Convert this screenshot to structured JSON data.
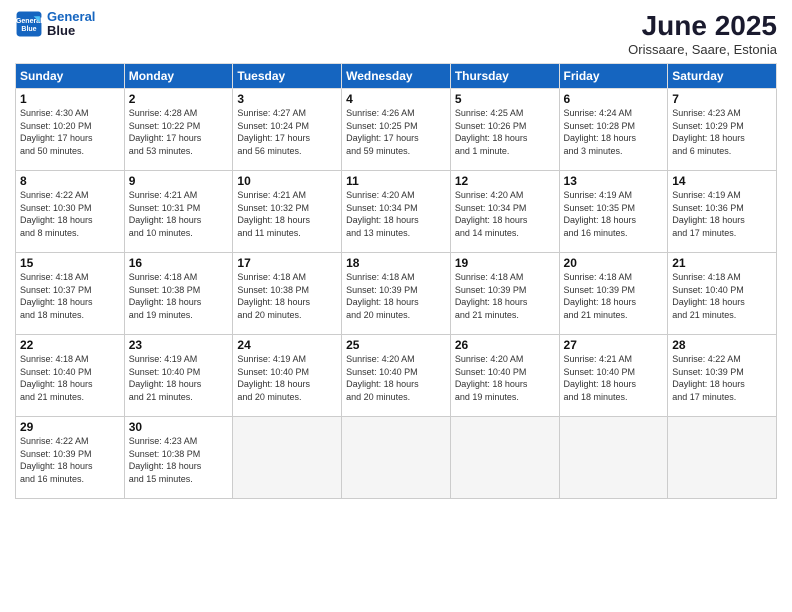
{
  "header": {
    "logo_line1": "General",
    "logo_line2": "Blue",
    "month": "June 2025",
    "location": "Orissaare, Saare, Estonia"
  },
  "weekdays": [
    "Sunday",
    "Monday",
    "Tuesday",
    "Wednesday",
    "Thursday",
    "Friday",
    "Saturday"
  ],
  "weeks": [
    [
      {
        "day": "1",
        "info": "Sunrise: 4:30 AM\nSunset: 10:20 PM\nDaylight: 17 hours\nand 50 minutes."
      },
      {
        "day": "2",
        "info": "Sunrise: 4:28 AM\nSunset: 10:22 PM\nDaylight: 17 hours\nand 53 minutes."
      },
      {
        "day": "3",
        "info": "Sunrise: 4:27 AM\nSunset: 10:24 PM\nDaylight: 17 hours\nand 56 minutes."
      },
      {
        "day": "4",
        "info": "Sunrise: 4:26 AM\nSunset: 10:25 PM\nDaylight: 17 hours\nand 59 minutes."
      },
      {
        "day": "5",
        "info": "Sunrise: 4:25 AM\nSunset: 10:26 PM\nDaylight: 18 hours\nand 1 minute."
      },
      {
        "day": "6",
        "info": "Sunrise: 4:24 AM\nSunset: 10:28 PM\nDaylight: 18 hours\nand 3 minutes."
      },
      {
        "day": "7",
        "info": "Sunrise: 4:23 AM\nSunset: 10:29 PM\nDaylight: 18 hours\nand 6 minutes."
      }
    ],
    [
      {
        "day": "8",
        "info": "Sunrise: 4:22 AM\nSunset: 10:30 PM\nDaylight: 18 hours\nand 8 minutes."
      },
      {
        "day": "9",
        "info": "Sunrise: 4:21 AM\nSunset: 10:31 PM\nDaylight: 18 hours\nand 10 minutes."
      },
      {
        "day": "10",
        "info": "Sunrise: 4:21 AM\nSunset: 10:32 PM\nDaylight: 18 hours\nand 11 minutes."
      },
      {
        "day": "11",
        "info": "Sunrise: 4:20 AM\nSunset: 10:34 PM\nDaylight: 18 hours\nand 13 minutes."
      },
      {
        "day": "12",
        "info": "Sunrise: 4:20 AM\nSunset: 10:34 PM\nDaylight: 18 hours\nand 14 minutes."
      },
      {
        "day": "13",
        "info": "Sunrise: 4:19 AM\nSunset: 10:35 PM\nDaylight: 18 hours\nand 16 minutes."
      },
      {
        "day": "14",
        "info": "Sunrise: 4:19 AM\nSunset: 10:36 PM\nDaylight: 18 hours\nand 17 minutes."
      }
    ],
    [
      {
        "day": "15",
        "info": "Sunrise: 4:18 AM\nSunset: 10:37 PM\nDaylight: 18 hours\nand 18 minutes."
      },
      {
        "day": "16",
        "info": "Sunrise: 4:18 AM\nSunset: 10:38 PM\nDaylight: 18 hours\nand 19 minutes."
      },
      {
        "day": "17",
        "info": "Sunrise: 4:18 AM\nSunset: 10:38 PM\nDaylight: 18 hours\nand 20 minutes."
      },
      {
        "day": "18",
        "info": "Sunrise: 4:18 AM\nSunset: 10:39 PM\nDaylight: 18 hours\nand 20 minutes."
      },
      {
        "day": "19",
        "info": "Sunrise: 4:18 AM\nSunset: 10:39 PM\nDaylight: 18 hours\nand 21 minutes."
      },
      {
        "day": "20",
        "info": "Sunrise: 4:18 AM\nSunset: 10:39 PM\nDaylight: 18 hours\nand 21 minutes."
      },
      {
        "day": "21",
        "info": "Sunrise: 4:18 AM\nSunset: 10:40 PM\nDaylight: 18 hours\nand 21 minutes."
      }
    ],
    [
      {
        "day": "22",
        "info": "Sunrise: 4:18 AM\nSunset: 10:40 PM\nDaylight: 18 hours\nand 21 minutes."
      },
      {
        "day": "23",
        "info": "Sunrise: 4:19 AM\nSunset: 10:40 PM\nDaylight: 18 hours\nand 21 minutes."
      },
      {
        "day": "24",
        "info": "Sunrise: 4:19 AM\nSunset: 10:40 PM\nDaylight: 18 hours\nand 20 minutes."
      },
      {
        "day": "25",
        "info": "Sunrise: 4:20 AM\nSunset: 10:40 PM\nDaylight: 18 hours\nand 20 minutes."
      },
      {
        "day": "26",
        "info": "Sunrise: 4:20 AM\nSunset: 10:40 PM\nDaylight: 18 hours\nand 19 minutes."
      },
      {
        "day": "27",
        "info": "Sunrise: 4:21 AM\nSunset: 10:40 PM\nDaylight: 18 hours\nand 18 minutes."
      },
      {
        "day": "28",
        "info": "Sunrise: 4:22 AM\nSunset: 10:39 PM\nDaylight: 18 hours\nand 17 minutes."
      }
    ],
    [
      {
        "day": "29",
        "info": "Sunrise: 4:22 AM\nSunset: 10:39 PM\nDaylight: 18 hours\nand 16 minutes."
      },
      {
        "day": "30",
        "info": "Sunrise: 4:23 AM\nSunset: 10:38 PM\nDaylight: 18 hours\nand 15 minutes."
      },
      {
        "day": "",
        "info": ""
      },
      {
        "day": "",
        "info": ""
      },
      {
        "day": "",
        "info": ""
      },
      {
        "day": "",
        "info": ""
      },
      {
        "day": "",
        "info": ""
      }
    ]
  ]
}
